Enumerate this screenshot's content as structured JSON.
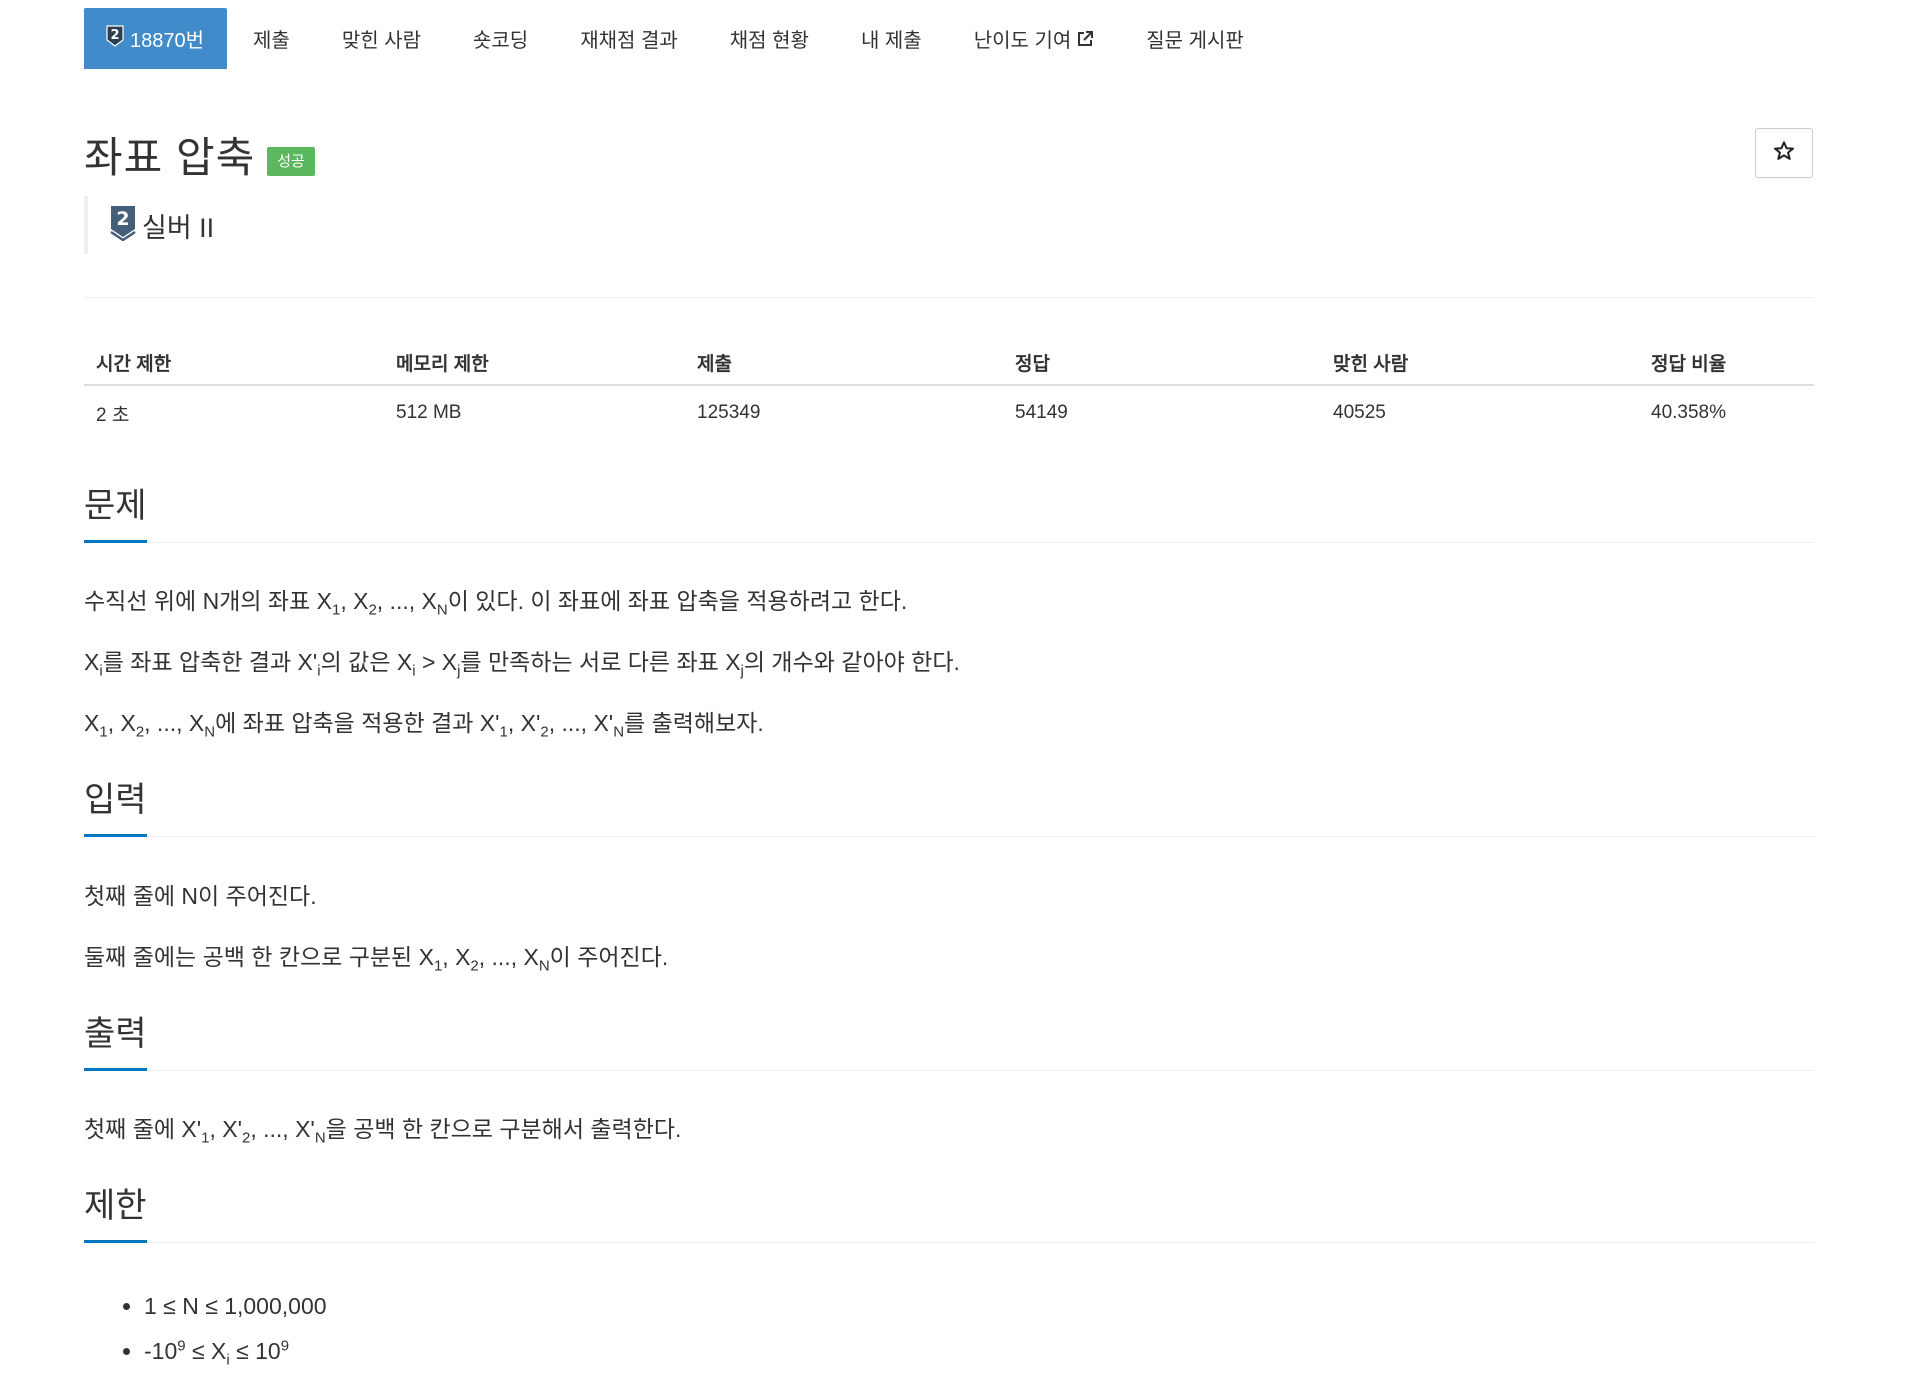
{
  "nav": {
    "problem_number": "18870번",
    "tier_icon_number": "2",
    "items": [
      {
        "label": "제출"
      },
      {
        "label": "맞힌 사람"
      },
      {
        "label": "숏코딩"
      },
      {
        "label": "재채점 결과"
      },
      {
        "label": "채점 현황"
      },
      {
        "label": "내 제출"
      },
      {
        "label": "난이도 기여",
        "external": true
      },
      {
        "label": "질문 게시판"
      }
    ]
  },
  "header": {
    "title": "좌표 압축",
    "badge": "성공",
    "tier_icon_number": "2",
    "tier": "실버 II",
    "star_icon": "star-outline-icon"
  },
  "info": {
    "headers": [
      "시간 제한",
      "메모리 제한",
      "제출",
      "정답",
      "맞힌 사람",
      "정답 비율"
    ],
    "values": [
      "2 초",
      "512 MB",
      "125349",
      "54149",
      "40525",
      "40.358%"
    ]
  },
  "sections": {
    "problem": "문제",
    "input": "입력",
    "output": "출력",
    "limits": "제한"
  },
  "text": {
    "x": "X",
    "xp": "X'",
    "n": "N",
    "i": "i",
    "j": "j",
    "one": "1",
    "two": "2",
    "sep": ", ",
    "ell": ", ..., ",
    "p1_a": "수직선 위에 N개의 좌표 ",
    "p1_b": "이 있다. 이 좌표에 좌표 압축을 적용하려고 한다.",
    "p2_a": "를 좌표 압축한 결과 ",
    "p2_b": "의 값은 ",
    "p2_c": " > ",
    "p2_d": "를 만족하는 서로 다른 좌표 ",
    "p2_e": "의 개수와 같아야 한다.",
    "p3_a": "에 좌표 압축을 적용한 결과 ",
    "p3_b": "를 출력해보자.",
    "in1": "첫째 줄에 N이 주어진다.",
    "in2_a": "둘째 줄에는 공백 한 칸으로 구분된 ",
    "in2_b": "이 주어진다.",
    "out_a": "첫째 줄에 ",
    "out_b": "을 공백 한 칸으로 구분해서 출력한다.",
    "lim1": "1 ≤ N ≤ 1,000,000",
    "lim2_a": "-10",
    "lim2_exp": "9",
    "lim2_b": " ≤ ",
    "lim2_c": " ≤ 10"
  },
  "colors": {
    "nav_active_bg": "#428bca",
    "badge_bg": "#5cb85c",
    "section_underline": "#0076c0",
    "tier_icon": "#435f7a"
  }
}
